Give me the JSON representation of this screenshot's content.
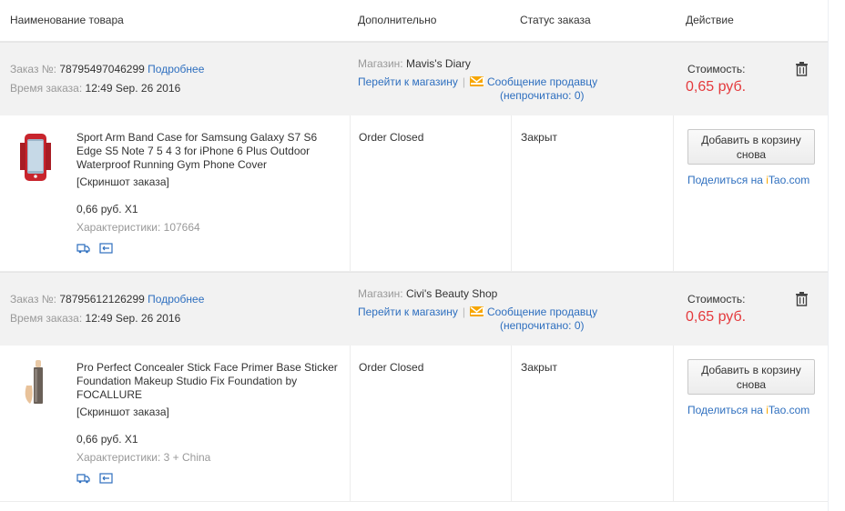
{
  "header": {
    "product": "Наименование товара",
    "additional": "Дополнительно",
    "status": "Статус заказа",
    "action": "Действие"
  },
  "orders": [
    {
      "order_label": "Заказ №:",
      "order_no": "78795497046299",
      "details_link": "Подробнее",
      "time_label": "Время заказа:",
      "time": "12:49 Sep. 26 2016",
      "store_label": "Магазин:",
      "store": "Mavis's Diary",
      "go_store": "Перейти к магазину",
      "message": "Сообщение продавцу",
      "unread_prefix": "(непрочитано:",
      "unread_count": "0",
      "unread_suffix": ")",
      "cost_label": "Стоимость:",
      "cost": "0,65 руб.",
      "product_name": "Sport Arm Band Case for Samsung Galaxy S7 S6 Edge S5 Note 7 5 4 3 for iPhone 6 Plus Outdoor Waterproof Running Gym Phone Cover",
      "snapshot": "[Скриншот заказа]",
      "price": "0,66 руб. X1",
      "specs": "Характеристики: 107664",
      "order_status": "Order Closed",
      "state": "Закрыт",
      "cart_button": "Добавить в корзину снова",
      "share": "Поделиться на",
      "itao_i": "i",
      "itao_rest": "Tao.com"
    },
    {
      "order_label": "Заказ №:",
      "order_no": "78795612126299",
      "details_link": "Подробнее",
      "time_label": "Время заказа:",
      "time": "12:49 Sep. 26 2016",
      "store_label": "Магазин:",
      "store": "Civi's Beauty Shop",
      "go_store": "Перейти к магазину",
      "message": "Сообщение продавцу",
      "unread_prefix": "(непрочитано:",
      "unread_count": "0",
      "unread_suffix": ")",
      "cost_label": "Стоимость:",
      "cost": "0,65 руб.",
      "product_name": "Pro Perfect Concealer Stick Face Primer Base Sticker Foundation Makeup Studio Fix Foundation by FOCALLURE",
      "snapshot": "[Скриншот заказа]",
      "price": "0,66 руб. X1",
      "specs": "Характеристики: 3 + China",
      "order_status": "Order Closed",
      "state": "Закрыт",
      "cart_button": "Добавить в корзину снова",
      "share": "Поделиться на",
      "itao_i": "i",
      "itao_rest": "Tao.com"
    }
  ],
  "colors": {
    "link": "#2e6fbf",
    "price_red": "#e4393c",
    "header_gray": "#f2f2f2",
    "message_orange": "#f7a600"
  },
  "icons": [
    "trash-icon",
    "envelope-icon",
    "truck-icon",
    "return-icon",
    "armband-product-image",
    "concealer-product-image"
  ]
}
